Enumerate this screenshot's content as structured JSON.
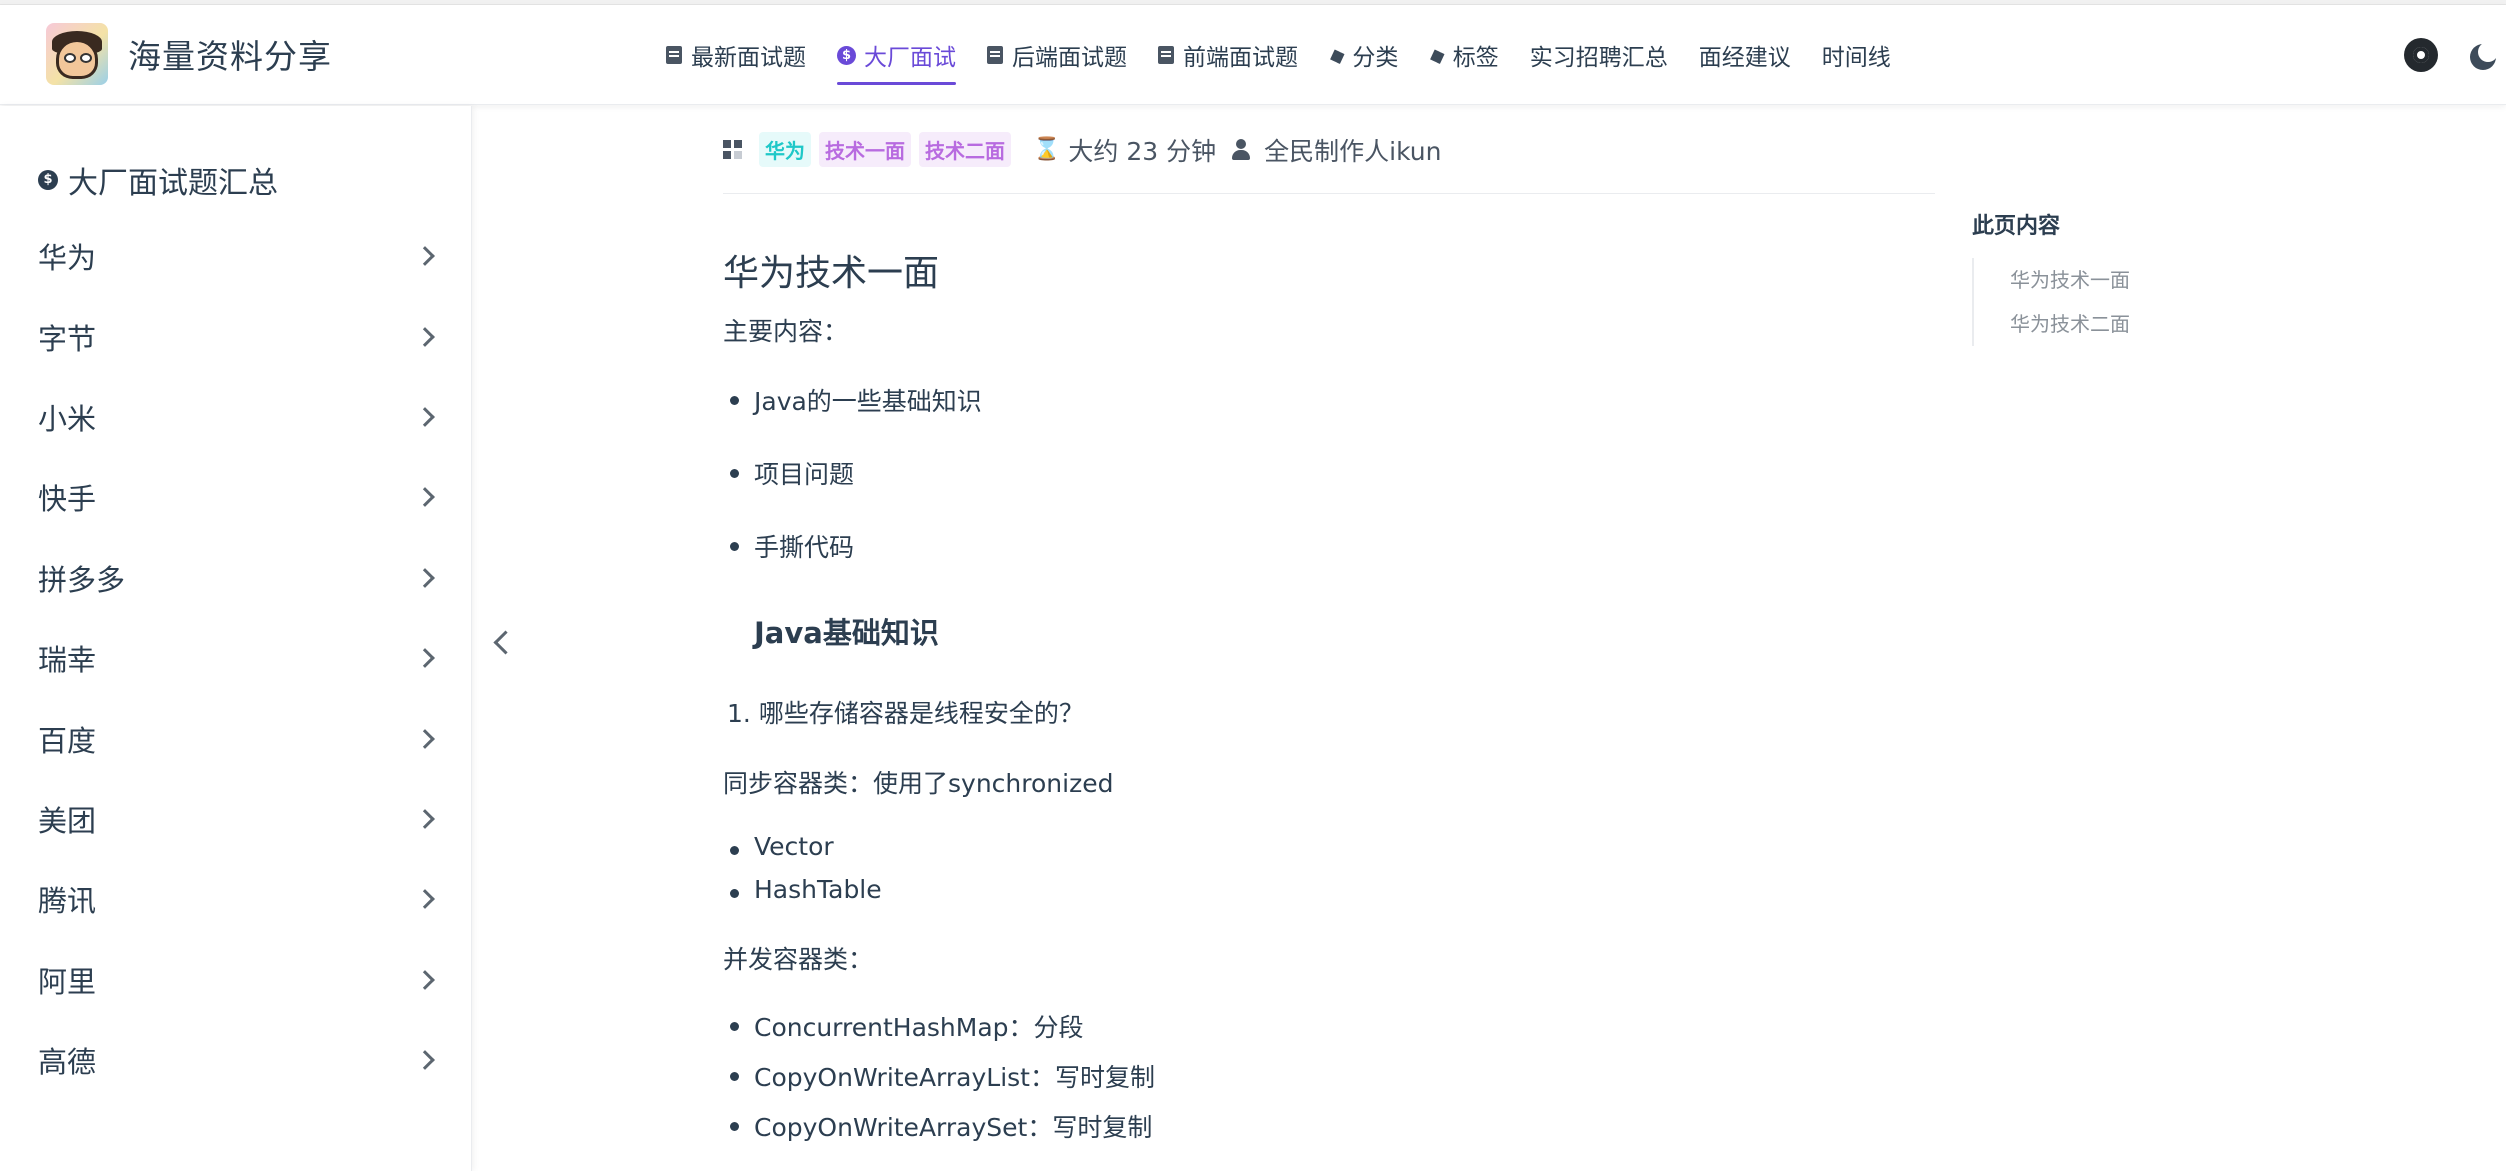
{
  "brand": {
    "title": "海量资料分享"
  },
  "nav": {
    "items": [
      {
        "label": "最新面试题",
        "icon": "document-icon",
        "active": false
      },
      {
        "label": "大厂面试",
        "icon": "dollar-icon",
        "active": true
      },
      {
        "label": "后端面试题",
        "icon": "document-icon",
        "active": false
      },
      {
        "label": "前端面试题",
        "icon": "document-icon",
        "active": false
      },
      {
        "label": "分类",
        "icon": "tag-icon",
        "active": false
      },
      {
        "label": "标签",
        "icon": "tag-icon",
        "active": false
      },
      {
        "label": "实习招聘汇总",
        "icon": "",
        "active": false
      },
      {
        "label": "面经建议",
        "icon": "",
        "active": false
      },
      {
        "label": "时间线",
        "icon": "",
        "active": false
      }
    ],
    "accent_color": "#6a4ad8"
  },
  "sidebar": {
    "heading": "大厂面试题汇总",
    "items": [
      "华为",
      "字节",
      "小米",
      "快手",
      "拼多多",
      "瑞幸",
      "百度",
      "美团",
      "腾讯",
      "阿里",
      "高德"
    ]
  },
  "meta": {
    "category": "华为",
    "tags": [
      "技术一面",
      "技术二面"
    ],
    "reading_time": "大约 23 分钟",
    "author": "全民制作人ikun"
  },
  "article": {
    "title": "华为技术一面",
    "intro": "主要内容：",
    "main_points": [
      "Java的一些基础知识",
      "项目问题",
      "手撕代码"
    ],
    "section_title": "Java基础知识",
    "question_1": "哪些存储容器是线程安全的？",
    "sync_heading": "同步容器类：使用了synchronized",
    "sync_items": [
      "Vector",
      "HashTable"
    ],
    "concurrent_heading": "并发容器类：",
    "concurrent_items": [
      "ConcurrentHashMap：分段",
      "CopyOnWriteArrayList：写时复制",
      "CopyOnWriteArraySet：写时复制"
    ]
  },
  "toc": {
    "title": "此页内容",
    "items": [
      "华为技术一面",
      "华为技术二面"
    ]
  }
}
